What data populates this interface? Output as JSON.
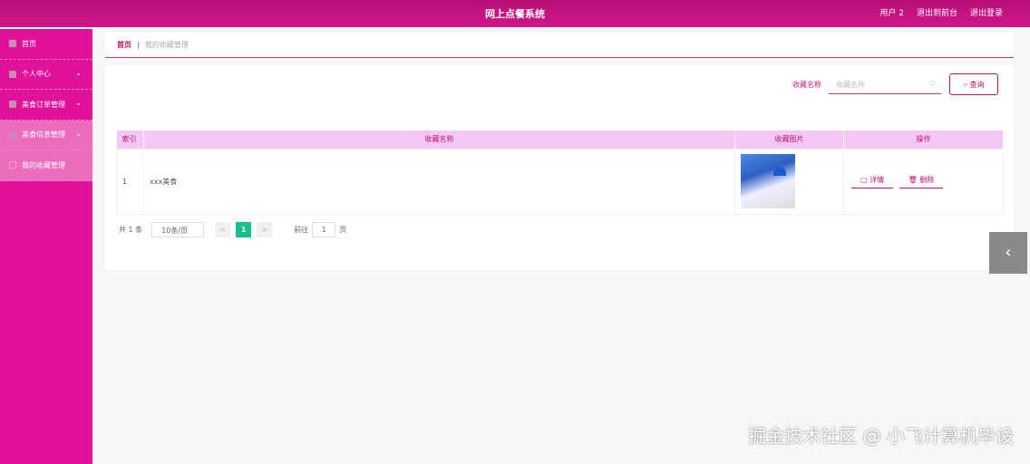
{
  "header": {
    "title": "网上点餐系统",
    "user": "用户 2",
    "to_front": "退出到前台",
    "logout": "退出登录"
  },
  "sidebar": {
    "items": [
      {
        "label": "首页"
      },
      {
        "label": "个人中心"
      },
      {
        "label": "美食订单管理"
      },
      {
        "label": "美食信息管理"
      },
      {
        "label": "我的收藏管理"
      }
    ]
  },
  "breadcrumb": {
    "home": "首页",
    "sep": "|",
    "current": "我的收藏管理"
  },
  "search": {
    "label": "收藏名称",
    "placeholder": "收藏名称",
    "button": "查询"
  },
  "table": {
    "headers": [
      "索引",
      "收藏名称",
      "收藏图片",
      "操作"
    ],
    "rows": [
      {
        "index": "1",
        "name": "xxx美食",
        "detail": "详情",
        "delete": "删除"
      }
    ]
  },
  "pager": {
    "total": "共 1 条",
    "page_size": "10条/页",
    "prev": "<",
    "current": "1",
    "next": ">",
    "goto": "前往",
    "goto_value": "1",
    "page_unit": "页"
  },
  "watermark": "掘金技术社区 @ 小飞计算机毕设"
}
